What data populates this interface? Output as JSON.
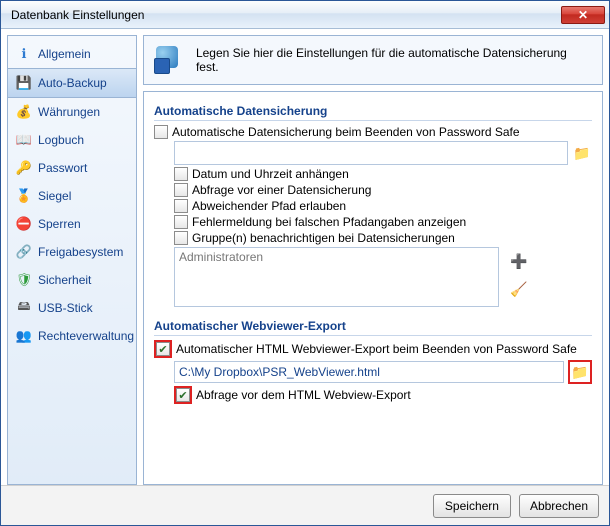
{
  "window": {
    "title": "Datenbank Einstellungen"
  },
  "info": {
    "text": "Legen Sie hier die Einstellungen für die automatische Datensicherung fest."
  },
  "sidebar": {
    "items": [
      {
        "label": "Allgemein"
      },
      {
        "label": "Auto-Backup"
      },
      {
        "label": "Währungen"
      },
      {
        "label": "Logbuch"
      },
      {
        "label": "Passwort"
      },
      {
        "label": "Siegel"
      },
      {
        "label": "Sperren"
      },
      {
        "label": "Freigabesystem"
      },
      {
        "label": "Sicherheit"
      },
      {
        "label": "USB-Stick"
      },
      {
        "label": "Rechteverwaltung"
      }
    ],
    "selected_index": 1
  },
  "groups": {
    "backup": {
      "title": "Automatische Datensicherung",
      "main_cb_label": "Automatische Datensicherung beim Beenden von Password Safe",
      "path_value": "",
      "options": [
        "Datum und Uhrzeit anhängen",
        "Abfrage vor einer Datensicherung",
        "Abweichender Pfad erlauben",
        "Fehlermeldung bei falschen Pfadangaben anzeigen",
        "Gruppe(n) benachrichtigen bei Datensicherungen"
      ],
      "groups_textarea": "Administratoren"
    },
    "webviewer": {
      "title": "Automatischer Webviewer-Export",
      "main_cb_label": "Automatischer HTML Webviewer-Export beim Beenden von Password Safe",
      "path_value": "C:\\My Dropbox\\PSR_WebViewer.html",
      "confirm_cb_label": "Abfrage vor dem HTML Webview-Export"
    }
  },
  "footer": {
    "save": "Speichern",
    "cancel": "Abbrechen"
  }
}
